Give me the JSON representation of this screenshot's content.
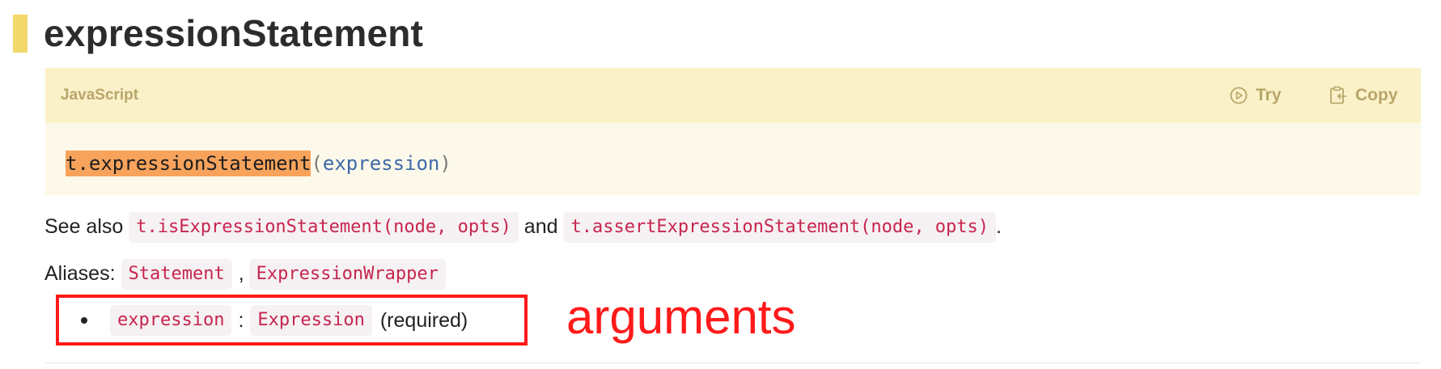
{
  "page": {
    "title": "expressionStatement"
  },
  "code_block": {
    "language": "JavaScript",
    "try_label": "Try",
    "copy_label": "Copy",
    "function_name": "t.expressionStatement",
    "open_paren": "(",
    "parameter": "expression",
    "close_paren": ")"
  },
  "see_also": {
    "prefix": "See also",
    "is_fn": "t.isExpressionStatement(node, opts)",
    "conjunction": "and",
    "assert_fn": "t.assertExpressionStatement(node, opts)",
    "suffix": "."
  },
  "aliases": {
    "label": "Aliases:",
    "items": [
      "Statement",
      "ExpressionWrapper"
    ],
    "separator": ","
  },
  "arguments": {
    "items": [
      {
        "name": "expression",
        "separator": ":",
        "type": "Expression",
        "note": "(required)"
      }
    ]
  },
  "annotation": {
    "label": "arguments",
    "color": "#ff1a1a"
  },
  "colors": {
    "heading_accent": "#f2d86b",
    "code_header_bg": "#fbf1c9",
    "code_body_bg": "#fdf9ea",
    "highlight": "#f7a35c",
    "inline_code": "#c7254e"
  }
}
